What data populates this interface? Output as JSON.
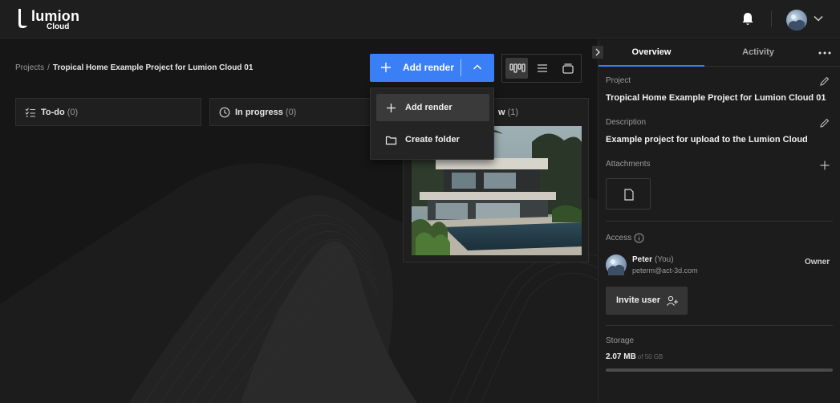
{
  "brand": {
    "name": "lumion",
    "sub": "Cloud"
  },
  "breadcrumb": {
    "root": "Projects",
    "separator": "/",
    "current": "Tropical Home Example Project for Lumion Cloud 01"
  },
  "toolbar": {
    "add_render_label": "Add render"
  },
  "dropdown": {
    "items": [
      {
        "label": "Add render",
        "icon": "plus-icon"
      },
      {
        "label": "Create folder",
        "icon": "folder-icon"
      }
    ]
  },
  "columns": [
    {
      "title": "To-do",
      "count": "(0)",
      "icon": "checklist-icon"
    },
    {
      "title": "In progress",
      "count": "(0)",
      "icon": "clock-icon"
    },
    {
      "title": "w",
      "count": "(1)"
    }
  ],
  "panel": {
    "tabs": [
      {
        "label": "Overview",
        "active": true
      },
      {
        "label": "Activity",
        "active": false
      }
    ],
    "project_label": "Project",
    "project_value": "Tropical Home Example Project for Lumion Cloud 01",
    "description_label": "Description",
    "description_value": "Example project for upload to the Lumion Cloud",
    "attachments_label": "Attachments",
    "access_label": "Access",
    "user": {
      "name": "Peter",
      "you": "(You)",
      "email": "peterm@act-3d.com",
      "role": "Owner"
    },
    "invite_label": "Invite user",
    "storage_label": "Storage",
    "storage_used": "2.07 MB",
    "storage_total": "of 50 GB",
    "storage_fraction": 4e-05
  },
  "colors": {
    "accent": "#3b7ff6",
    "background": "#141414",
    "panel": "#1c1c1c"
  }
}
